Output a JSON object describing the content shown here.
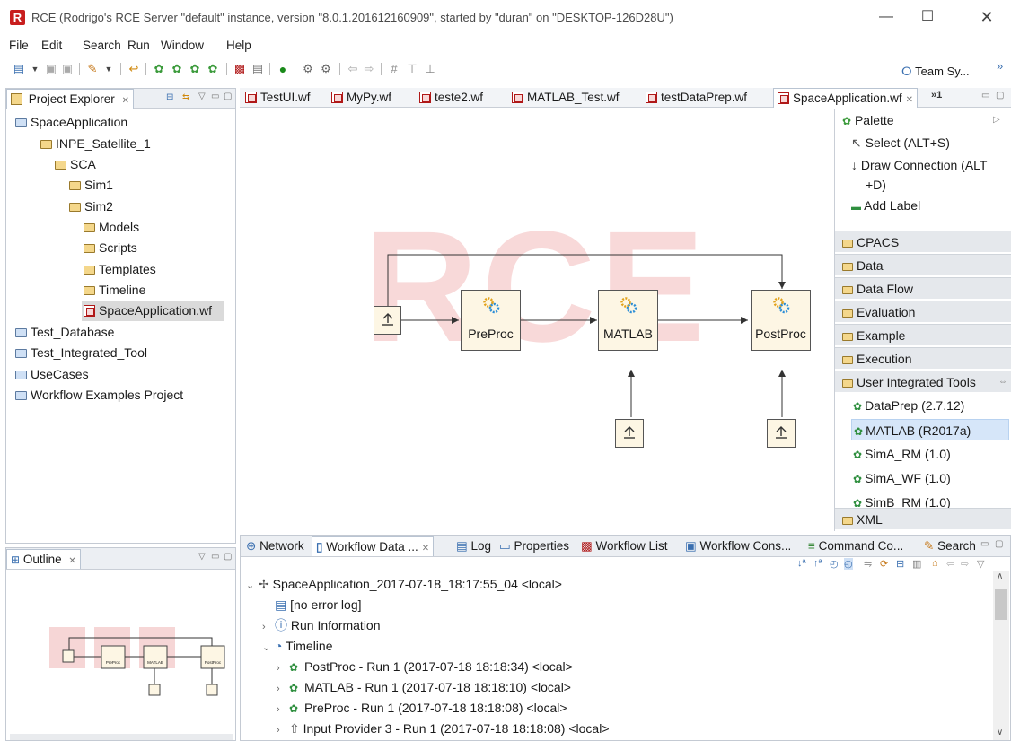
{
  "window": {
    "title": "RCE (Rodrigo's RCE Server \"default\" instance, version \"8.0.1.201612160909\", started by \"duran\" on \"DESKTOP-126D28U\")",
    "logo_letter": "R",
    "minimize": "—",
    "maximize": "☐",
    "close": "✕"
  },
  "menu": [
    "File",
    "Edit",
    "Search",
    "Run",
    "Window",
    "Help"
  ],
  "toolbar": {
    "team_sync_label": "Team Sy...",
    "overflow": "»"
  },
  "project_explorer": {
    "title": "Project Explorer",
    "tree": [
      {
        "label": "SpaceApplication",
        "kind": "project"
      },
      {
        "label": "INPE_Satellite_1",
        "kind": "folder"
      },
      {
        "label": "SCA",
        "kind": "folder"
      },
      {
        "label": "Sim1",
        "kind": "folder"
      },
      {
        "label": "Sim2",
        "kind": "folder"
      },
      {
        "label": "Models",
        "kind": "folder"
      },
      {
        "label": "Scripts",
        "kind": "folder"
      },
      {
        "label": "Templates",
        "kind": "folder"
      },
      {
        "label": "Timeline",
        "kind": "folder"
      },
      {
        "label": "SpaceApplication.wf",
        "kind": "workflow",
        "selected": true
      },
      {
        "label": "Test_Database",
        "kind": "project"
      },
      {
        "label": "Test_Integrated_Tool",
        "kind": "project"
      },
      {
        "label": "UseCases",
        "kind": "project"
      },
      {
        "label": "Workflow Examples Project",
        "kind": "project"
      }
    ]
  },
  "outline": {
    "title": "Outline"
  },
  "editor": {
    "tabs": [
      "TestUI.wf",
      "MyPy.wf",
      "teste2.wf",
      "MATLAB_Test.wf",
      "testDataPrep.wf",
      "SpaceApplication.wf"
    ],
    "active_tab": "SpaceApplication.wf",
    "overflow_tabs": "»1",
    "watermark": "RCE",
    "nodes": {
      "preproc": "PreProc",
      "matlab": "MATLAB",
      "postproc": "PostProc"
    }
  },
  "palette": {
    "title": "Palette",
    "tools": [
      {
        "label": "Select (ALT+S)",
        "icon": "cursor-icon"
      },
      {
        "label": "Draw Connection (ALT +D)",
        "icon": "connection-icon"
      },
      {
        "label": "Add Label",
        "icon": "label-icon"
      }
    ],
    "drawers": [
      "CPACS",
      "Data",
      "Data Flow",
      "Evaluation",
      "Example",
      "Execution",
      "User Integrated Tools"
    ],
    "user_tools": [
      "DataPrep (2.7.12)",
      "MATLAB (R2017a)",
      "SimA_RM (1.0)",
      "SimA_WF (1.0)",
      "SimB_RM (1.0)"
    ],
    "selected_tool": "MATLAB (R2017a)",
    "last_drawer": "XML"
  },
  "bottom_tabs": [
    "Network",
    "Workflow Data ...",
    "Log",
    "Properties",
    "Workflow List",
    "Workflow Cons...",
    "Command Co...",
    "Search"
  ],
  "bottom_active_tab": "Workflow Data ...",
  "workflow_data": {
    "root": "SpaceApplication_2017-07-18_18:17:55_04 <local>",
    "items": [
      {
        "label": "[no error log]",
        "level": 1,
        "twisty": ""
      },
      {
        "label": "Run Information",
        "level": 1,
        "twisty": "›"
      },
      {
        "label": "Timeline",
        "level": 1,
        "twisty": "⌄"
      },
      {
        "label": "PostProc - Run 1 (2017-07-18 18:18:34)  <local>",
        "level": 2,
        "twisty": "›"
      },
      {
        "label": "MATLAB - Run 1 (2017-07-18 18:18:10)  <local>",
        "level": 2,
        "twisty": "›"
      },
      {
        "label": "PreProc - Run 1 (2017-07-18 18:18:08)  <local>",
        "level": 2,
        "twisty": "›"
      },
      {
        "label": "Input Provider 3 - Run 1 (2017-07-18 18:18:08)  <local>",
        "level": 2,
        "twisty": "›"
      }
    ]
  }
}
